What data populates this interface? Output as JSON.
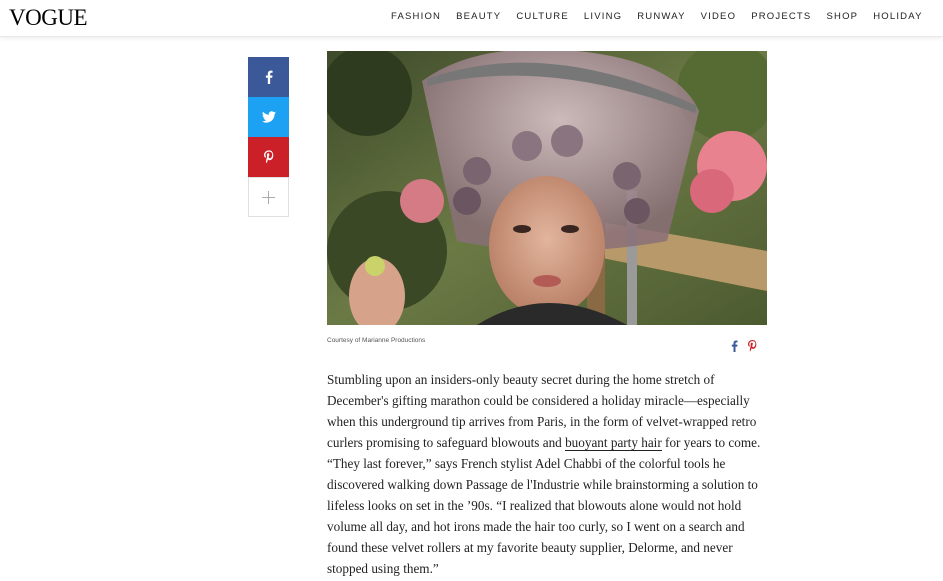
{
  "brand": {
    "logo": "VOGUE"
  },
  "nav": {
    "items": [
      "FASHION",
      "BEAUTY",
      "CULTURE",
      "LIVING",
      "RUNWAY",
      "VIDEO",
      "PROJECTS",
      "SHOP",
      "HOLIDAY"
    ]
  },
  "share": {
    "facebook_icon": "facebook-icon",
    "twitter_icon": "twitter-icon",
    "pinterest_icon": "pinterest-icon",
    "more_icon": "plus-icon",
    "colors": {
      "facebook": "#3b5998",
      "twitter": "#1da1f2",
      "pinterest": "#cb2027"
    }
  },
  "image": {
    "caption": "Courtesy of Marianne Productions"
  },
  "article": {
    "paragraph_before_link": "Stumbling upon an insiders-only beauty secret during the home stretch of December's gifting marathon could be considered a holiday miracle—especially when this underground tip arrives from Paris, in the form of velvet-wrapped retro curlers promising to safeguard blowouts and ",
    "link_text": "buoyant party hair",
    "paragraph_after_link": " for years to come. “They last forever,” says French stylist Adel Chabbi of the colorful tools he discovered walking down Passage de l'Industrie while brainstorming a solution to lifeless looks on set in the ’90s. “I realized that blowouts alone would not hold volume all day, and hot irons made the hair too curly, so I went on a search and found these velvet rollers at my favorite beauty supplier, Delorme, and never stopped using them.”"
  }
}
